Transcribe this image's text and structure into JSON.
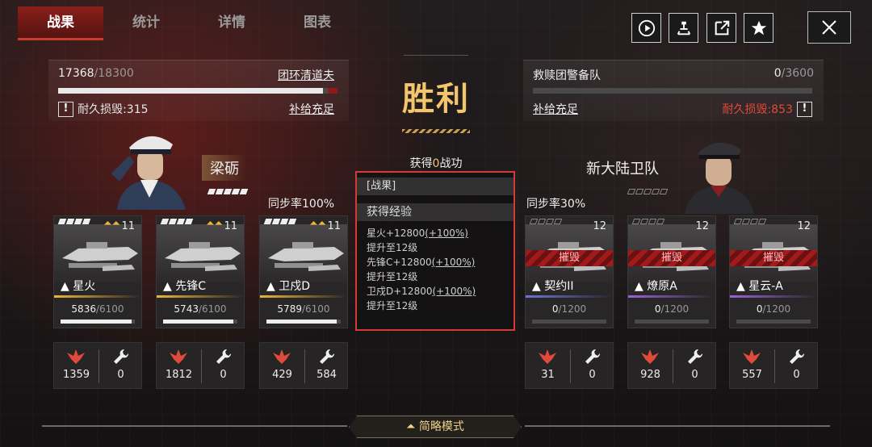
{
  "tabs": [
    "战果",
    "统计",
    "详情",
    "图表"
  ],
  "toolbar": {
    "icons": [
      "play-icon",
      "share-node-icon",
      "external-link-icon",
      "star-icon"
    ],
    "close": "close-icon"
  },
  "left_fleet": {
    "durability": "17368",
    "durability_max": "/18300",
    "durability_fraction": 0.949,
    "name": "团环清道夫",
    "loss_label": "耐久损毁:315",
    "supply": "补给充足",
    "bang": "!"
  },
  "right_fleet": {
    "name": "救赎团警备队",
    "durability": "0",
    "durability_max": "/3600",
    "durability_fraction": 0.0,
    "loss_label": "耐久损毁:853",
    "supply": "补给充足",
    "bang": "!"
  },
  "result": {
    "title": "胜利",
    "gain_text": "获得",
    "gain_value": "0",
    "gain_suffix": "战功"
  },
  "left_commander": {
    "name": "梁砺",
    "sync": "同步率100%"
  },
  "right_commander": {
    "name": "新大陆卫队",
    "sync": "同步率30%"
  },
  "result_box": {
    "section1": "[战果]",
    "section2": "获得经验",
    "lines": [
      {
        "text": "星火+12800",
        "pct": "(+100%)"
      },
      {
        "text": "提升至12级",
        "pct": ""
      },
      {
        "text": "先锋C+12800",
        "pct": "(+100%)"
      },
      {
        "text": "提升至12级",
        "pct": ""
      },
      {
        "text": "卫戍D+12800",
        "pct": "(+100%)"
      },
      {
        "text": "提升至12级",
        "pct": ""
      }
    ]
  },
  "left_ships": [
    {
      "name": "星火",
      "hp": "5836",
      "hp_max": "/6100",
      "hp_fraction": 0.957,
      "level": "11",
      "damage": "1359",
      "repair": "0",
      "color": "#f0b33b"
    },
    {
      "name": "先锋C",
      "hp": "5743",
      "hp_max": "/6100",
      "hp_fraction": 0.941,
      "level": "11",
      "damage": "1812",
      "repair": "0",
      "color": "#f0b33b"
    },
    {
      "name": "卫戍D",
      "hp": "5789",
      "hp_max": "/6100",
      "hp_fraction": 0.949,
      "level": "11",
      "damage": "429",
      "repair": "584",
      "color": "#f0b33b"
    }
  ],
  "right_ships": [
    {
      "name": "契约II",
      "hp": "0",
      "hp_max": "/1200",
      "hp_fraction": 0.0,
      "level": "12",
      "damage": "31",
      "repair": "0",
      "status": "摧毁",
      "color": "#6b76d8"
    },
    {
      "name": "燎原A",
      "hp": "0",
      "hp_max": "/1200",
      "hp_fraction": 0.0,
      "level": "12",
      "damage": "928",
      "repair": "0",
      "status": "摧毁",
      "color": "#9a63d8"
    },
    {
      "name": "星云-A",
      "hp": "0",
      "hp_max": "/1200",
      "hp_fraction": 0.0,
      "level": "12",
      "damage": "557",
      "repair": "0",
      "status": "摧毁",
      "color": "#9a63d8"
    }
  ],
  "footer": {
    "label": "简略模式"
  }
}
